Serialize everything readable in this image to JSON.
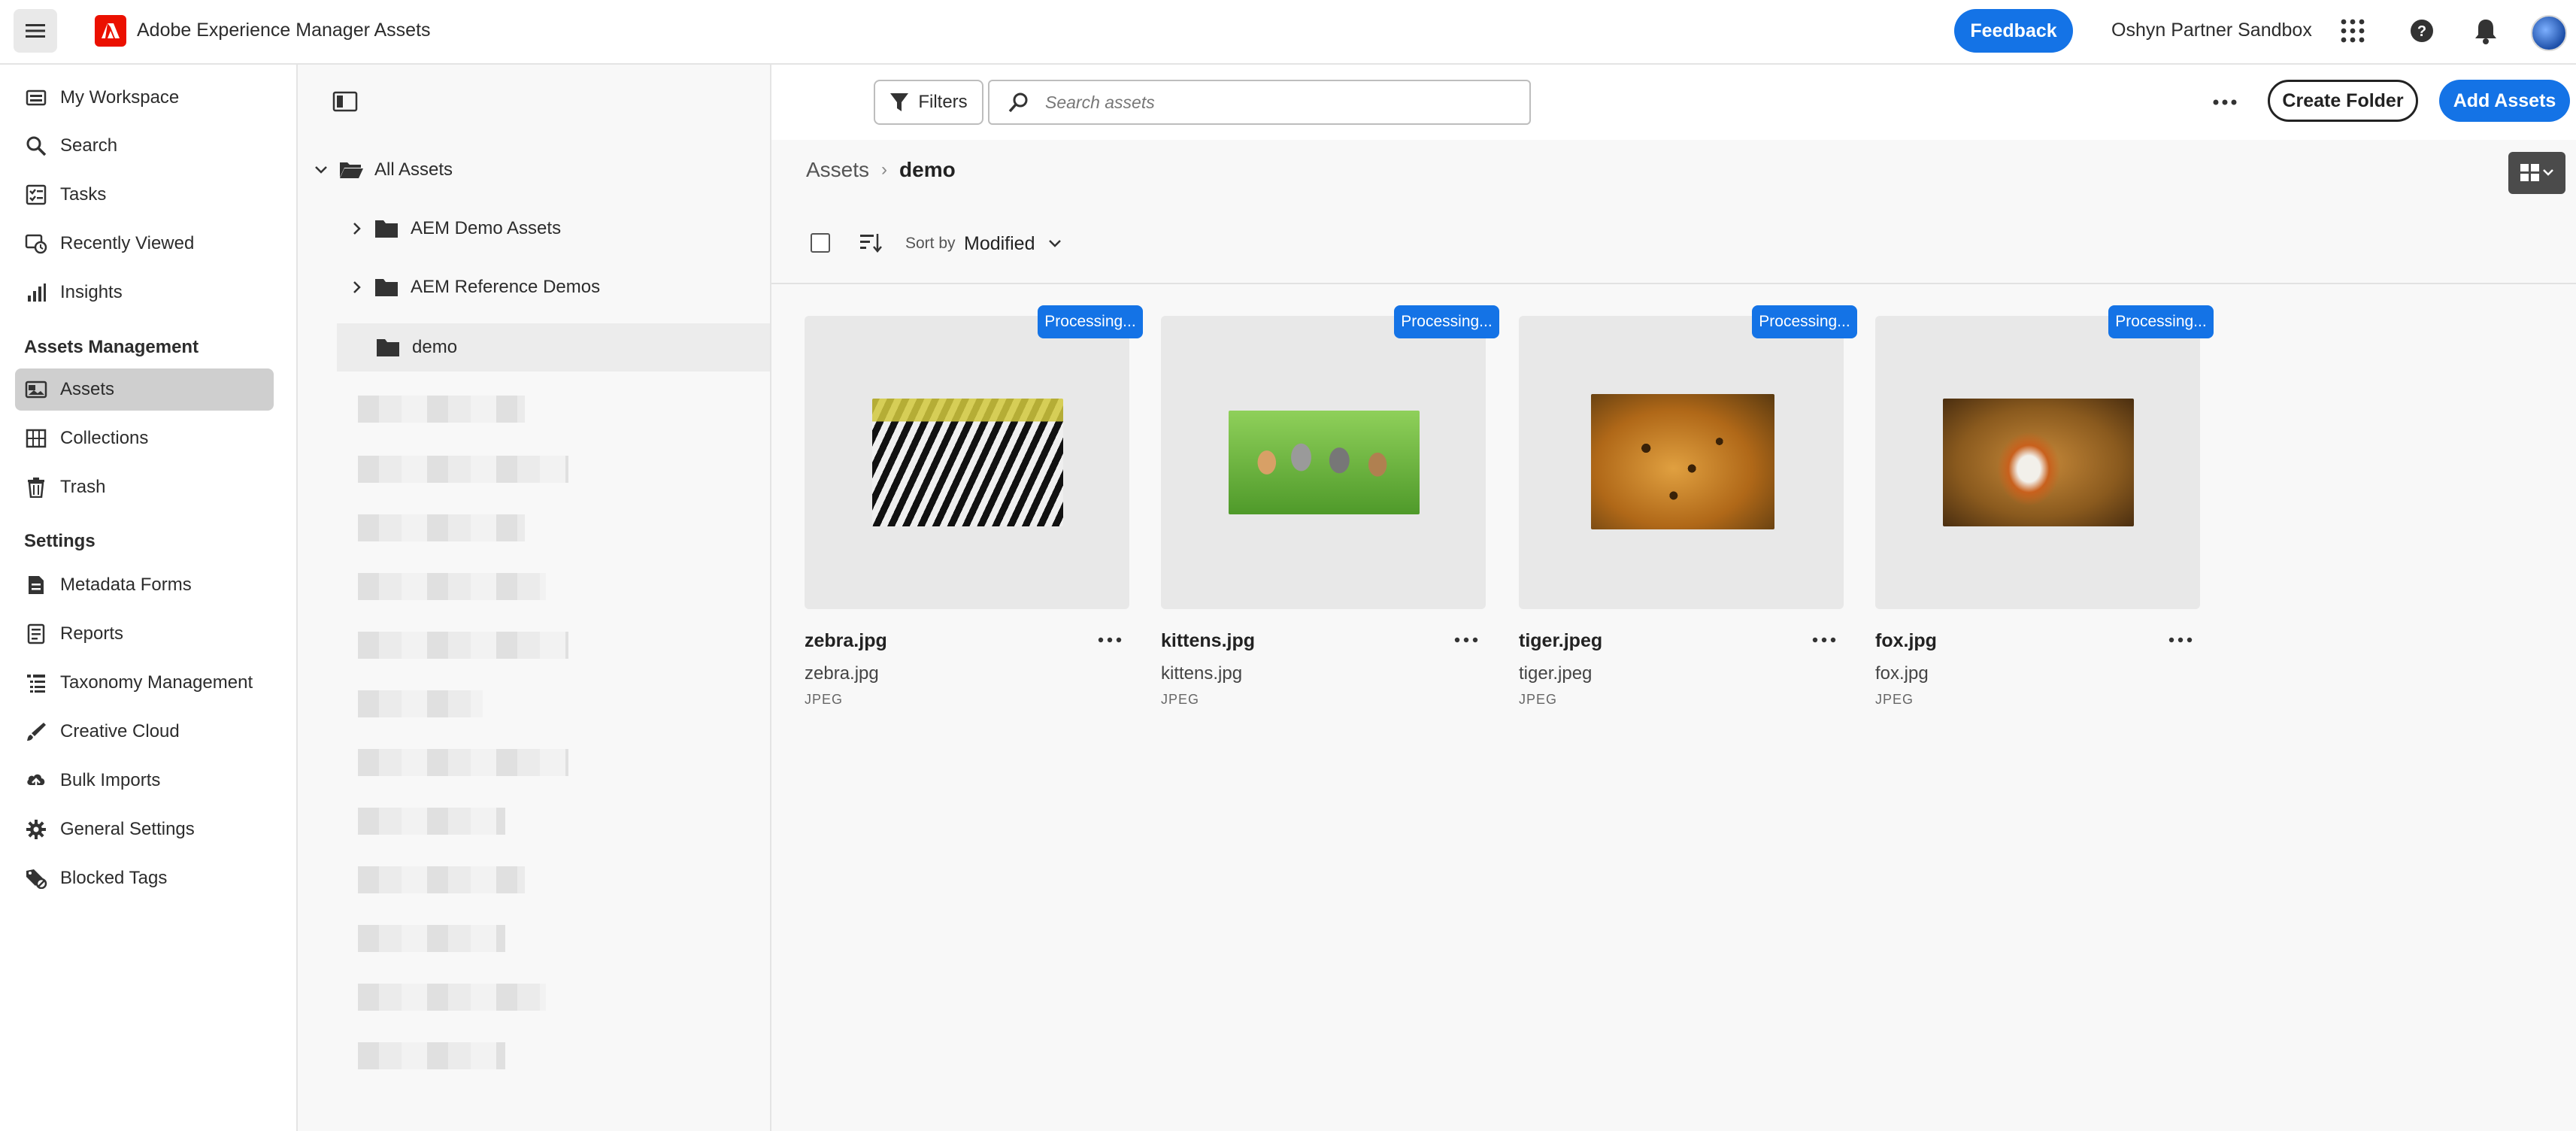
{
  "header": {
    "app_title": "Adobe Experience Manager Assets",
    "feedback_label": "Feedback",
    "org_name": "Oshyn Partner Sandbox",
    "icons": [
      "menu-icon",
      "adobe-logo",
      "apps-grid-icon",
      "help-icon",
      "bell-icon",
      "avatar"
    ]
  },
  "sidebar": {
    "items": [
      {
        "label": "My Workspace",
        "icon": "workspace-icon"
      },
      {
        "label": "Search",
        "icon": "search-icon"
      },
      {
        "label": "Tasks",
        "icon": "tasks-icon"
      },
      {
        "label": "Recently Viewed",
        "icon": "recent-icon"
      },
      {
        "label": "Insights",
        "icon": "insights-icon"
      }
    ],
    "section_assets": "Assets Management",
    "assets_items": [
      {
        "label": "Assets",
        "icon": "assets-icon",
        "active": true
      },
      {
        "label": "Collections",
        "icon": "collections-icon"
      },
      {
        "label": "Trash",
        "icon": "trash-icon"
      }
    ],
    "section_settings": "Settings",
    "settings_items": [
      {
        "label": "Metadata Forms",
        "icon": "metadata-forms-icon"
      },
      {
        "label": "Reports",
        "icon": "reports-icon"
      },
      {
        "label": "Taxonomy Management",
        "icon": "taxonomy-icon"
      },
      {
        "label": "Creative Cloud",
        "icon": "creative-cloud-icon"
      },
      {
        "label": "Bulk Imports",
        "icon": "bulk-imports-icon"
      },
      {
        "label": "General Settings",
        "icon": "gear-icon"
      },
      {
        "label": "Blocked Tags",
        "icon": "blocked-tags-icon"
      }
    ]
  },
  "tree": {
    "root": "All Assets",
    "folders": [
      {
        "label": "AEM Demo Assets",
        "expandable": true
      },
      {
        "label": "AEM Reference Demos",
        "expandable": true
      },
      {
        "label": "demo",
        "expandable": false,
        "selected": true
      }
    ]
  },
  "toolbar": {
    "filters_label": "Filters",
    "search_placeholder": "Search assets",
    "create_folder_label": "Create Folder",
    "add_assets_label": "Add Assets"
  },
  "content": {
    "breadcrumb_root": "Assets",
    "breadcrumb_separator": "›",
    "breadcrumb_current": "demo",
    "sort_by_label": "Sort by",
    "sort_by_value": "Modified",
    "assets": [
      {
        "title": "zebra.jpg",
        "filename": "zebra.jpg",
        "type": "JPEG",
        "status": "Processing..."
      },
      {
        "title": "kittens.jpg",
        "filename": "kittens.jpg",
        "type": "JPEG",
        "status": "Processing..."
      },
      {
        "title": "tiger.jpeg",
        "filename": "tiger.jpeg",
        "type": "JPEG",
        "status": "Processing..."
      },
      {
        "title": "fox.jpg",
        "filename": "fox.jpg",
        "type": "JPEG",
        "status": "Processing..."
      }
    ]
  },
  "colors": {
    "accent": "#1473e6",
    "adobe_red": "#eb1000",
    "active_nav": "#cfcfcf"
  }
}
